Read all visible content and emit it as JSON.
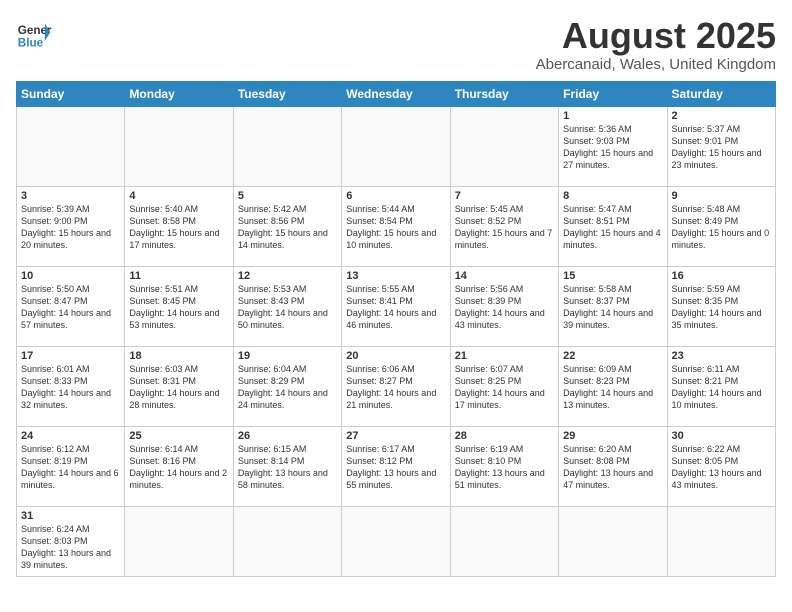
{
  "header": {
    "logo_general": "General",
    "logo_blue": "Blue",
    "title": "August 2025",
    "subtitle": "Abercanaid, Wales, United Kingdom"
  },
  "days_of_week": [
    "Sunday",
    "Monday",
    "Tuesday",
    "Wednesday",
    "Thursday",
    "Friday",
    "Saturday"
  ],
  "weeks": [
    [
      {
        "day": "",
        "content": ""
      },
      {
        "day": "",
        "content": ""
      },
      {
        "day": "",
        "content": ""
      },
      {
        "day": "",
        "content": ""
      },
      {
        "day": "",
        "content": ""
      },
      {
        "day": "1",
        "content": "Sunrise: 5:36 AM\nSunset: 9:03 PM\nDaylight: 15 hours and 27 minutes."
      },
      {
        "day": "2",
        "content": "Sunrise: 5:37 AM\nSunset: 9:01 PM\nDaylight: 15 hours and 23 minutes."
      }
    ],
    [
      {
        "day": "3",
        "content": "Sunrise: 5:39 AM\nSunset: 9:00 PM\nDaylight: 15 hours and 20 minutes."
      },
      {
        "day": "4",
        "content": "Sunrise: 5:40 AM\nSunset: 8:58 PM\nDaylight: 15 hours and 17 minutes."
      },
      {
        "day": "5",
        "content": "Sunrise: 5:42 AM\nSunset: 8:56 PM\nDaylight: 15 hours and 14 minutes."
      },
      {
        "day": "6",
        "content": "Sunrise: 5:44 AM\nSunset: 8:54 PM\nDaylight: 15 hours and 10 minutes."
      },
      {
        "day": "7",
        "content": "Sunrise: 5:45 AM\nSunset: 8:52 PM\nDaylight: 15 hours and 7 minutes."
      },
      {
        "day": "8",
        "content": "Sunrise: 5:47 AM\nSunset: 8:51 PM\nDaylight: 15 hours and 4 minutes."
      },
      {
        "day": "9",
        "content": "Sunrise: 5:48 AM\nSunset: 8:49 PM\nDaylight: 15 hours and 0 minutes."
      }
    ],
    [
      {
        "day": "10",
        "content": "Sunrise: 5:50 AM\nSunset: 8:47 PM\nDaylight: 14 hours and 57 minutes."
      },
      {
        "day": "11",
        "content": "Sunrise: 5:51 AM\nSunset: 8:45 PM\nDaylight: 14 hours and 53 minutes."
      },
      {
        "day": "12",
        "content": "Sunrise: 5:53 AM\nSunset: 8:43 PM\nDaylight: 14 hours and 50 minutes."
      },
      {
        "day": "13",
        "content": "Sunrise: 5:55 AM\nSunset: 8:41 PM\nDaylight: 14 hours and 46 minutes."
      },
      {
        "day": "14",
        "content": "Sunrise: 5:56 AM\nSunset: 8:39 PM\nDaylight: 14 hours and 43 minutes."
      },
      {
        "day": "15",
        "content": "Sunrise: 5:58 AM\nSunset: 8:37 PM\nDaylight: 14 hours and 39 minutes."
      },
      {
        "day": "16",
        "content": "Sunrise: 5:59 AM\nSunset: 8:35 PM\nDaylight: 14 hours and 35 minutes."
      }
    ],
    [
      {
        "day": "17",
        "content": "Sunrise: 6:01 AM\nSunset: 8:33 PM\nDaylight: 14 hours and 32 minutes."
      },
      {
        "day": "18",
        "content": "Sunrise: 6:03 AM\nSunset: 8:31 PM\nDaylight: 14 hours and 28 minutes."
      },
      {
        "day": "19",
        "content": "Sunrise: 6:04 AM\nSunset: 8:29 PM\nDaylight: 14 hours and 24 minutes."
      },
      {
        "day": "20",
        "content": "Sunrise: 6:06 AM\nSunset: 8:27 PM\nDaylight: 14 hours and 21 minutes."
      },
      {
        "day": "21",
        "content": "Sunrise: 6:07 AM\nSunset: 8:25 PM\nDaylight: 14 hours and 17 minutes."
      },
      {
        "day": "22",
        "content": "Sunrise: 6:09 AM\nSunset: 8:23 PM\nDaylight: 14 hours and 13 minutes."
      },
      {
        "day": "23",
        "content": "Sunrise: 6:11 AM\nSunset: 8:21 PM\nDaylight: 14 hours and 10 minutes."
      }
    ],
    [
      {
        "day": "24",
        "content": "Sunrise: 6:12 AM\nSunset: 8:19 PM\nDaylight: 14 hours and 6 minutes."
      },
      {
        "day": "25",
        "content": "Sunrise: 6:14 AM\nSunset: 8:16 PM\nDaylight: 14 hours and 2 minutes."
      },
      {
        "day": "26",
        "content": "Sunrise: 6:15 AM\nSunset: 8:14 PM\nDaylight: 13 hours and 58 minutes."
      },
      {
        "day": "27",
        "content": "Sunrise: 6:17 AM\nSunset: 8:12 PM\nDaylight: 13 hours and 55 minutes."
      },
      {
        "day": "28",
        "content": "Sunrise: 6:19 AM\nSunset: 8:10 PM\nDaylight: 13 hours and 51 minutes."
      },
      {
        "day": "29",
        "content": "Sunrise: 6:20 AM\nSunset: 8:08 PM\nDaylight: 13 hours and 47 minutes."
      },
      {
        "day": "30",
        "content": "Sunrise: 6:22 AM\nSunset: 8:05 PM\nDaylight: 13 hours and 43 minutes."
      }
    ],
    [
      {
        "day": "31",
        "content": "Sunrise: 6:24 AM\nSunset: 8:03 PM\nDaylight: 13 hours and 39 minutes."
      },
      {
        "day": "",
        "content": ""
      },
      {
        "day": "",
        "content": ""
      },
      {
        "day": "",
        "content": ""
      },
      {
        "day": "",
        "content": ""
      },
      {
        "day": "",
        "content": ""
      },
      {
        "day": "",
        "content": ""
      }
    ]
  ]
}
